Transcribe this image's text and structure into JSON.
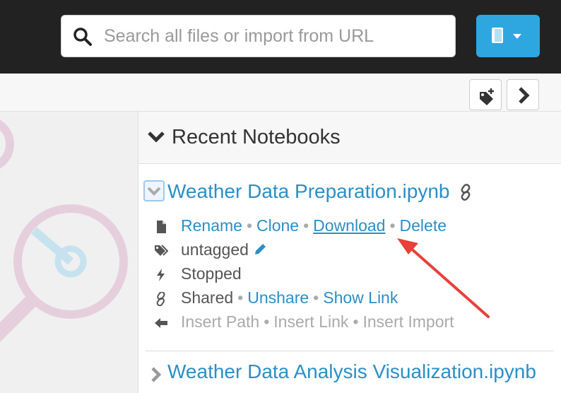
{
  "search": {
    "placeholder": "Search all files or import from URL"
  },
  "recent": {
    "title": "Recent Notebooks",
    "notebook1": {
      "title": "Weather Data Preparation.ipynb",
      "actions": {
        "rename": "Rename",
        "clone": "Clone",
        "download": "Download",
        "delete": "Delete"
      },
      "tags": "untagged",
      "status": "Stopped",
      "sharing": {
        "state": "Shared",
        "unshare": "Unshare",
        "show_link": "Show Link"
      },
      "insert": {
        "path": "Insert Path",
        "link": "Insert Link",
        "import": "Insert Import"
      }
    },
    "notebook2": {
      "title": "Weather Data Analysis Visualization.ipynb"
    }
  },
  "separator": "•",
  "colors": {
    "accent": "#2ea7e0",
    "link": "#2a8fc7",
    "annotation_arrow": "#e8403a"
  }
}
